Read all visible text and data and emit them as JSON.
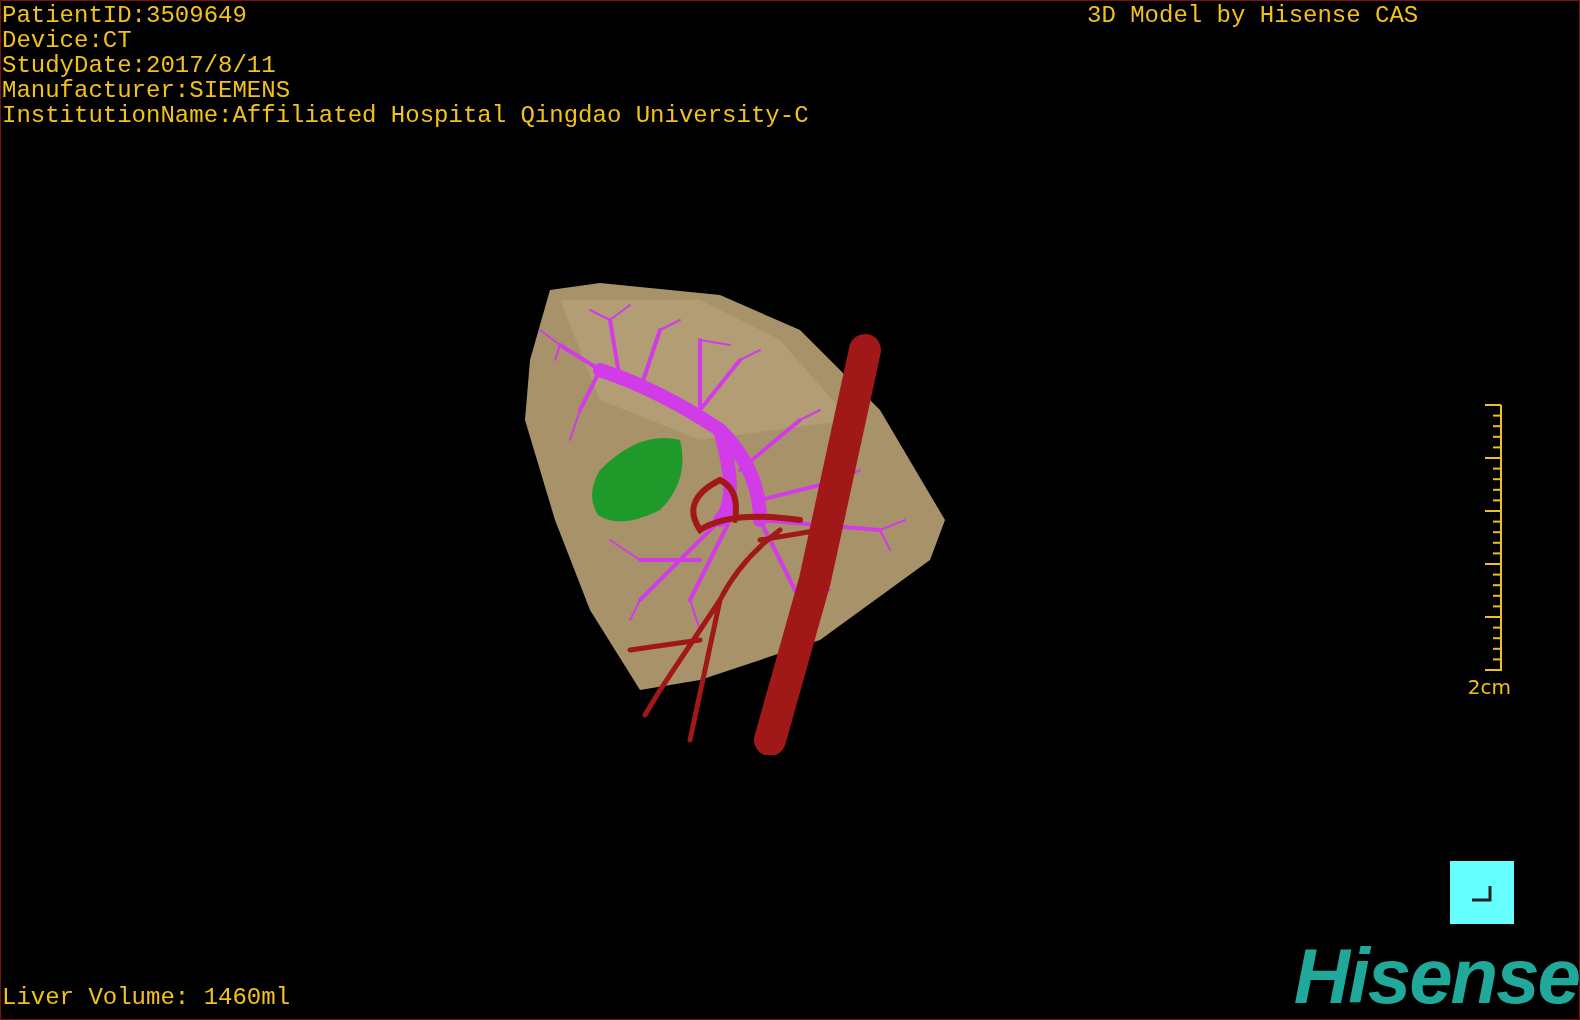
{
  "info_lines": [
    "PatientID:3509649",
    "Device:CT",
    "StudyDate:2017/8/11",
    "Manufacturer:SIEMENS",
    "InstitutionName:Affiliated Hospital Qingdao University-C"
  ],
  "title": "3D Model by Hisense CAS",
  "scale_bar": {
    "label": "2cm"
  },
  "volume": "Liver Volume: 1460ml",
  "logo": "Hisense"
}
